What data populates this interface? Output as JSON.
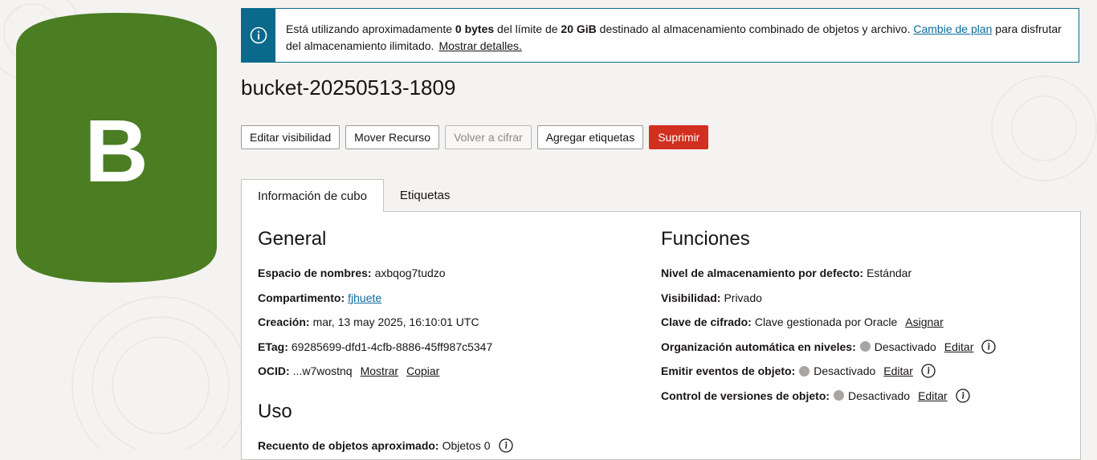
{
  "bucket_icon": {
    "letter": "B",
    "color": "#4b7d23"
  },
  "banner": {
    "part1": "Está utilizando aproximadamente ",
    "used": "0 bytes",
    "part2": " del límite de ",
    "limit": "20 GiB",
    "part3": " destinado al almacenamiento combinado de objetos y archivo. ",
    "change_plan_link": "Cambie de plan",
    "part4": " para disfrutar del almacenamiento ilimitado.",
    "details_link": "Mostrar detalles."
  },
  "title": "bucket-20250513-1809",
  "actions": {
    "edit_visibility": "Editar visibilidad",
    "move_resource": "Mover Recurso",
    "re_encrypt": "Volver a cifrar",
    "add_tags": "Agregar etiquetas",
    "delete": "Suprimir"
  },
  "tabs": {
    "info": "Información de cubo",
    "tags": "Etiquetas"
  },
  "general": {
    "heading": "General",
    "namespace_label": "Espacio de nombres:",
    "namespace_value": "axbqog7tudzo",
    "compartment_label": "Compartimento:",
    "compartment_value": "fjhuete",
    "created_label": "Creación:",
    "created_value": "mar, 13 may 2025, 16:10:01 UTC",
    "etag_label": "ETag:",
    "etag_value": "69285699-dfd1-4cfb-8886-45ff987c5347",
    "ocid_label": "OCID:",
    "ocid_value": "...w7wostnq",
    "show_link": "Mostrar",
    "copy_link": "Copiar"
  },
  "usage": {
    "heading": "Uso",
    "count_label": "Recuento de objetos aproximado:",
    "count_value": "Objetos 0"
  },
  "features": {
    "heading": "Funciones",
    "tier_label": "Nivel de almacenamiento por defecto:",
    "tier_value": "Estándar",
    "visibility_label": "Visibilidad:",
    "visibility_value": "Privado",
    "encryption_label": "Clave de cifrado:",
    "encryption_value": "Clave gestionada por Oracle",
    "assign_link": "Asignar",
    "auto_tiering_label": "Organización automática en niveles:",
    "auto_tiering_value": "Desactivado",
    "events_label": "Emitir eventos de objeto:",
    "events_value": "Desactivado",
    "versioning_label": "Control de versiones de objeto:",
    "versioning_value": "Desactivado",
    "edit_link": "Editar"
  }
}
